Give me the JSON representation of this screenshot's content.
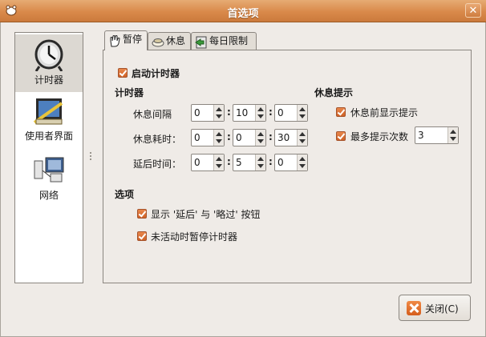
{
  "window": {
    "title": "首选项"
  },
  "sidebar": {
    "items": [
      {
        "label": "计时器",
        "icon": "clock-icon",
        "selected": true
      },
      {
        "label": "使用者界面",
        "icon": "ui-design-icon"
      },
      {
        "label": "网络",
        "icon": "network-icon"
      }
    ]
  },
  "tabs": [
    {
      "label": "暂停",
      "icon": "hand-icon",
      "active": true
    },
    {
      "label": "休息",
      "icon": "cup-icon"
    },
    {
      "label": "每日限制",
      "icon": "limit-icon"
    }
  ],
  "pause": {
    "enable_label": "启动计时器",
    "timer_section": "计时器",
    "rows": [
      {
        "label": "休息间隔",
        "h": "0",
        "m": "10",
        "s": "0"
      },
      {
        "label": "休息耗时：",
        "h": "0",
        "m": "0",
        "s": "30"
      },
      {
        "label": "延后时间：",
        "h": "0",
        "m": "5",
        "s": "0"
      }
    ],
    "colon": ":",
    "rest_section": "休息提示",
    "show_before_label": "休息前显示提示",
    "max_prompts_label": "最多提示次数",
    "max_prompts_value": "3",
    "options_section": "选项",
    "show_buttons_label": "显示 '延后' 与 '略过' 按钮",
    "idle_pause_label": "未活动时暂停计时器"
  },
  "close_button": {
    "label": "关闭(C)"
  },
  "colors": {
    "titlebar": "#d9894a",
    "accent": "#e06a2c"
  }
}
